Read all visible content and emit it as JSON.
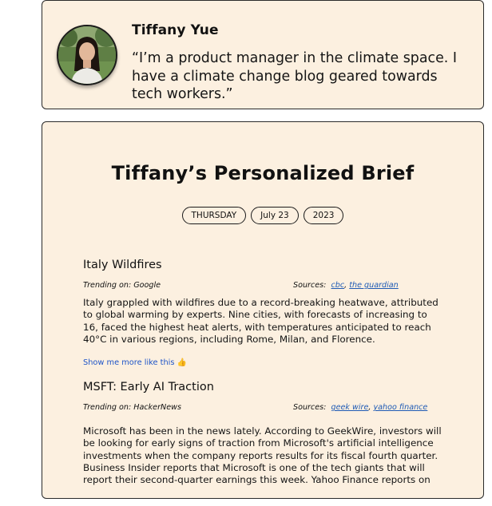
{
  "profile": {
    "name": "Tiffany Yue",
    "quote": "“I’m a product manager in the climate space. I have a climate change blog geared towards tech workers.”",
    "avatar_icon": "person-photo"
  },
  "brief": {
    "title": "Tiffany’s Personalized Brief",
    "date": {
      "weekday": "THURSDAY",
      "month_day": "July 23",
      "year": "2023"
    },
    "stories": [
      {
        "title": "Italy Wildfires",
        "trending_label": "Trending on: Google",
        "sources_label": "Sources:",
        "sources": [
          "cbc",
          "the guardian"
        ],
        "body": "Italy grappled with wildfires due to a record-breaking heatwave, attributed to global warming by experts. Nine cities, with forecasts of increasing to 16, faced the highest heat alerts, with temperatures anticipated to reach 40°C in various regions, including Rome, Milan, and Florence.",
        "more_link": "Show me more like this 👍"
      },
      {
        "title": "MSFT: Early AI Traction",
        "trending_label": "Trending on: HackerNews",
        "sources_label": "Sources:",
        "sources": [
          "geek wire",
          "yahoo finance"
        ],
        "body": "Microsoft has been in the news lately. According to GeekWire, investors will be looking for early signs of traction from Microsoft's artificial intelligence investments when the company reports results for its fiscal fourth quarter. Business Insider reports that Microsoft is one of the tech giants that will report their second-quarter earnings this week. Yahoo Finance reports on"
      }
    ]
  },
  "colors": {
    "card_bg": "#fcf0e0",
    "link": "#1f5bb5",
    "border": "#2a2a2a"
  }
}
